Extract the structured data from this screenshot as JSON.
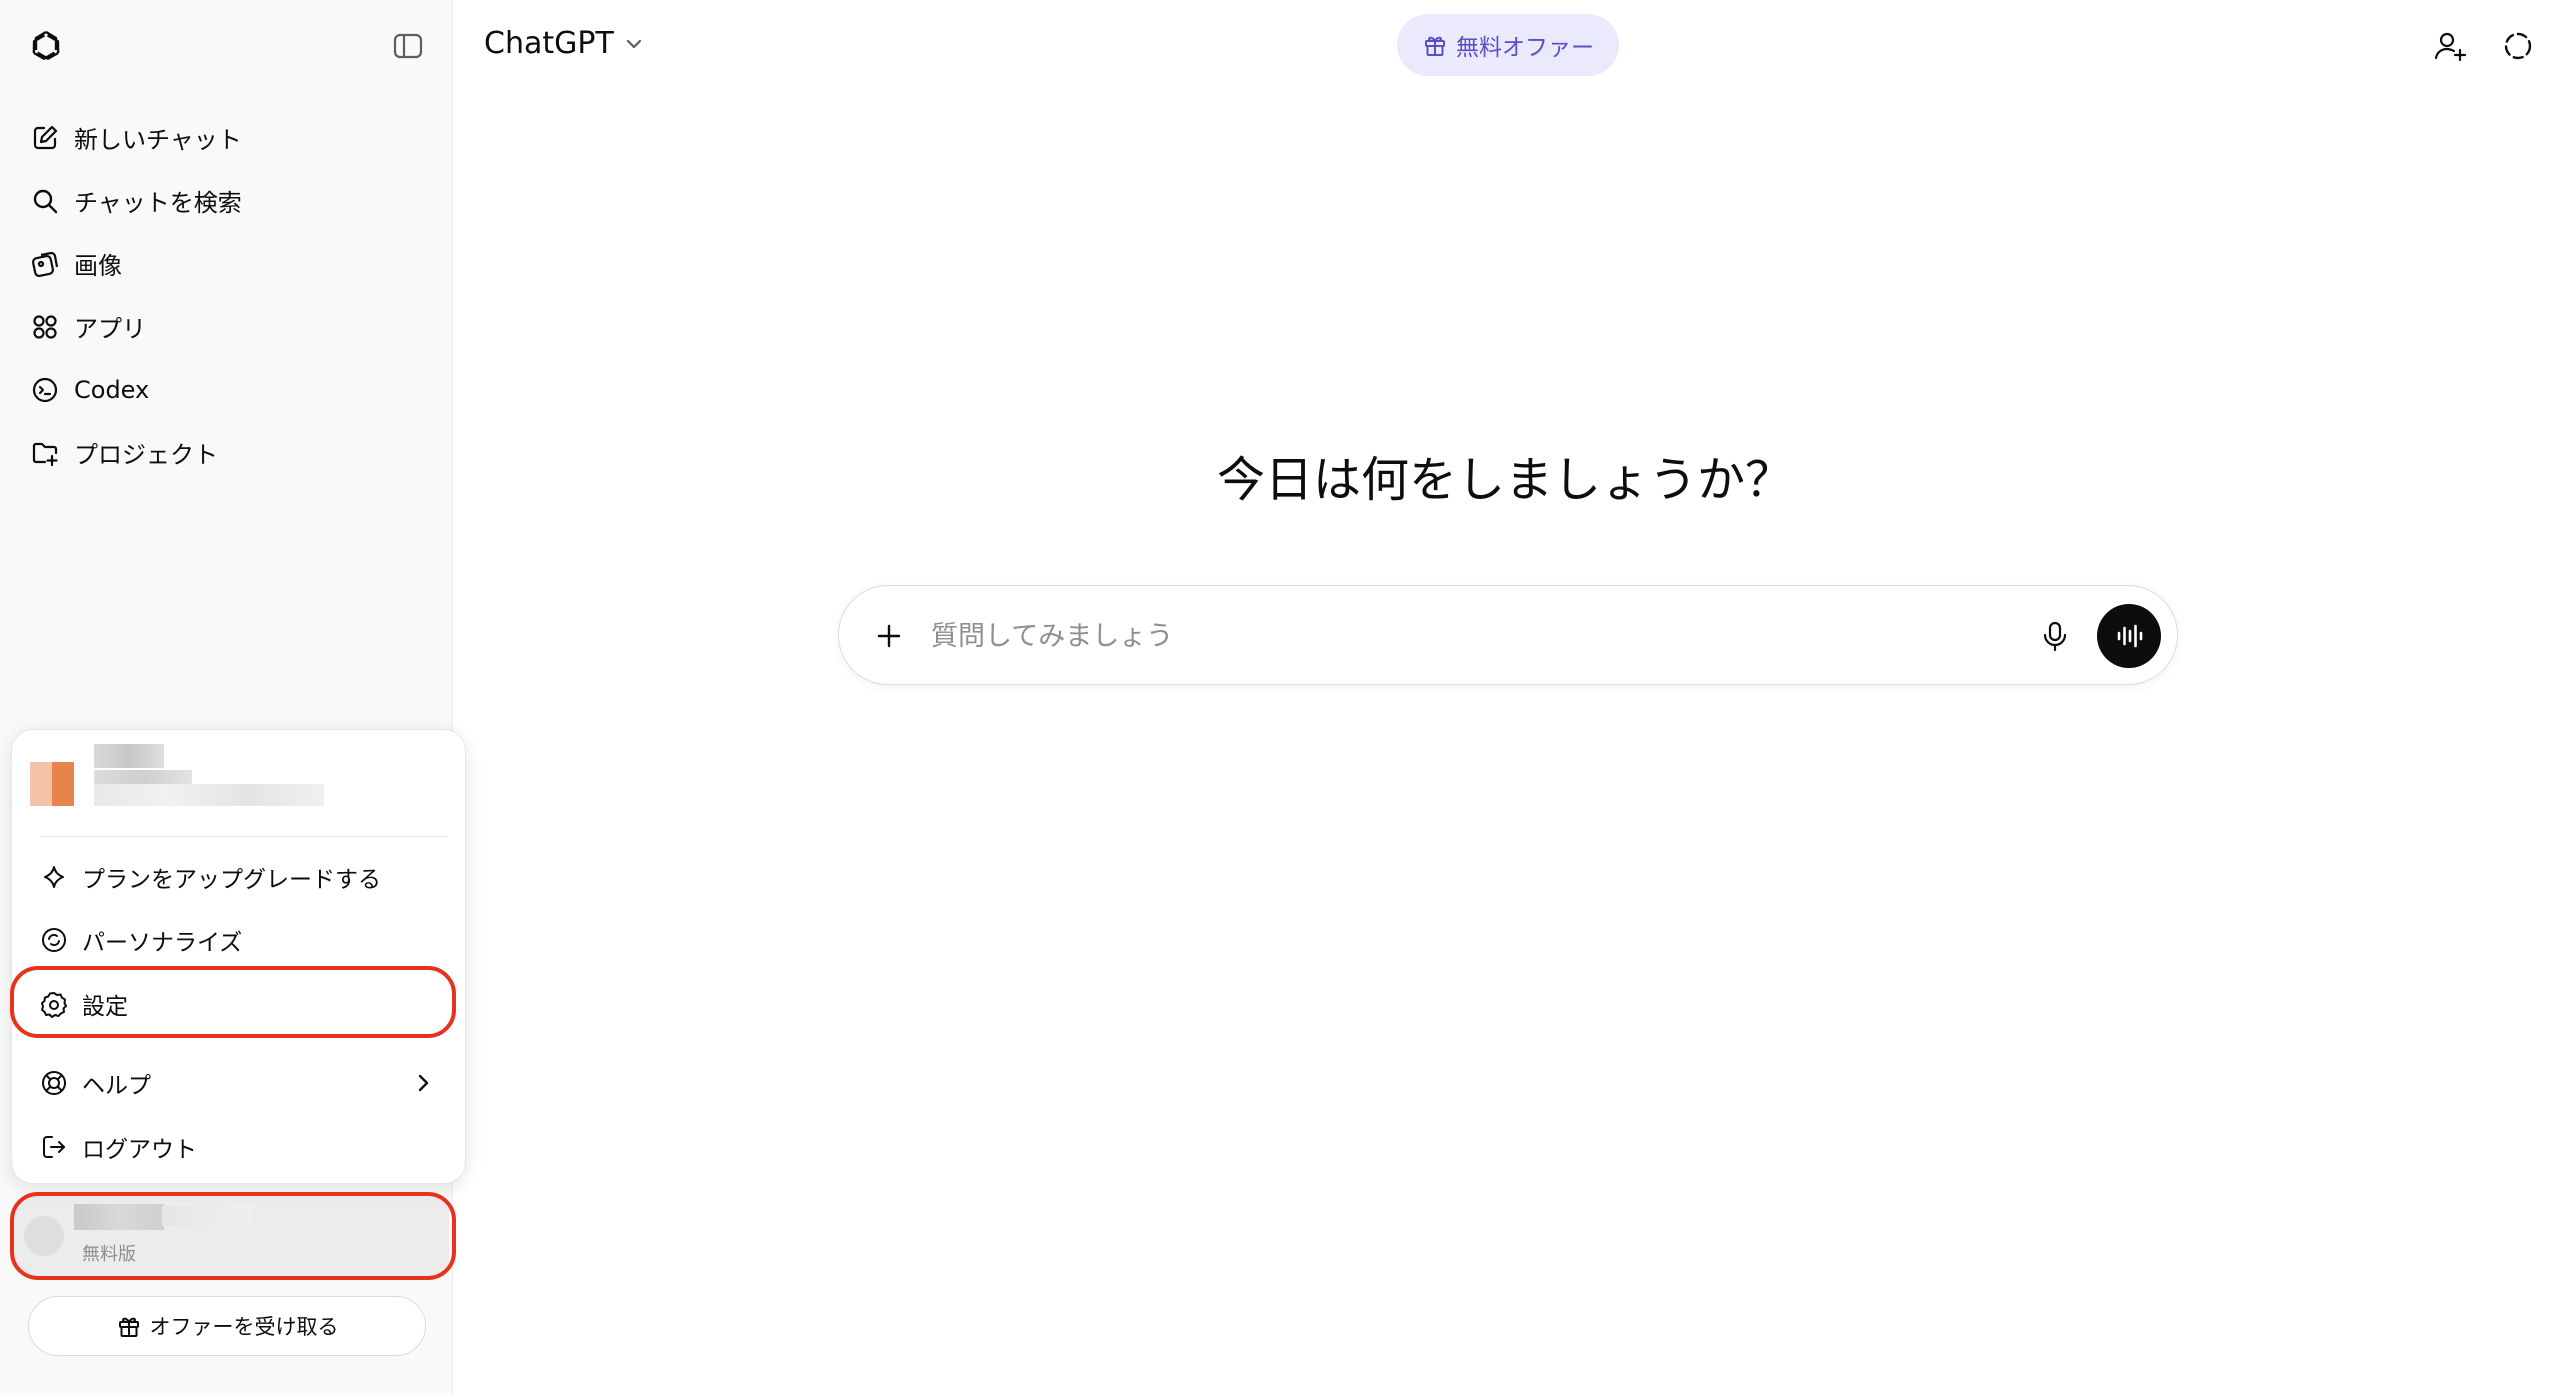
{
  "sidebar": {
    "nav": [
      {
        "label": "新しいチャット",
        "icon": "new-chat-icon"
      },
      {
        "label": "チャットを検索",
        "icon": "search-icon"
      },
      {
        "label": "画像",
        "icon": "image-icon"
      },
      {
        "label": "アプリ",
        "icon": "apps-icon"
      },
      {
        "label": "Codex",
        "icon": "codex-icon"
      },
      {
        "label": "プロジェクト",
        "icon": "folder-plus-icon"
      }
    ],
    "menu": {
      "items": [
        {
          "label": "プランをアップグレードする",
          "icon": "sparkle-icon"
        },
        {
          "label": "パーソナライズ",
          "icon": "personalize-icon"
        },
        {
          "label": "設定",
          "icon": "gear-icon"
        },
        {
          "label": "ヘルプ",
          "icon": "lifebuoy-icon"
        },
        {
          "label": "ログアウト",
          "icon": "logout-icon"
        }
      ]
    },
    "user": {
      "plan": "無料版"
    },
    "offer_button": "オファーを受け取る"
  },
  "header": {
    "model": "ChatGPT",
    "free_offer": "無料オファー"
  },
  "main": {
    "heading": "今日は何をしましょうか？",
    "composer": {
      "placeholder": "質問してみましょう"
    }
  },
  "colors": {
    "highlight": "#e8321e",
    "offer_pill_bg": "#ebeafc",
    "offer_pill_text": "#5a4fc8"
  }
}
